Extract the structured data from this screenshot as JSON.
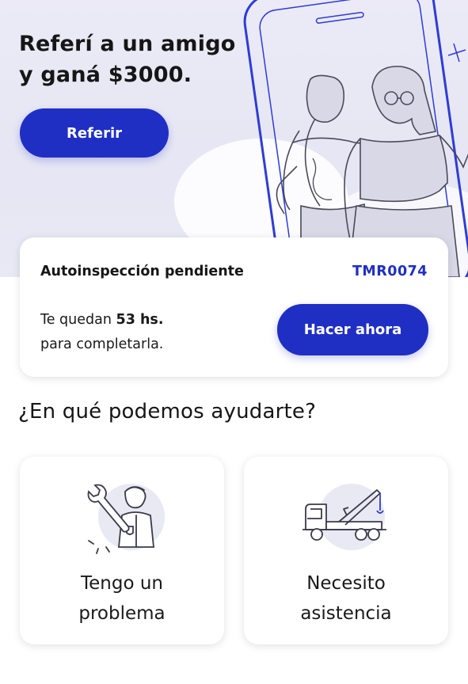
{
  "hero": {
    "title_line1": "Referí a un amigo",
    "title_line2": "y ganá $3000.",
    "refer_button": "Referir"
  },
  "pending": {
    "title": "Autoinspección pendiente",
    "code": "TMR0074",
    "text_prefix": "Te quedan",
    "hours": "53 hs.",
    "text_suffix": "para completarla.",
    "action_button": "Hacer ahora"
  },
  "help": {
    "title": "¿En qué podemos ayudarte?",
    "options": [
      {
        "label": "Tengo un problema",
        "icon": "mechanic-wrench-icon"
      },
      {
        "label": "Necesito asistencia",
        "icon": "tow-truck-icon"
      }
    ]
  },
  "colors": {
    "accent": "#1f2fc4",
    "hero_background": "#e7e6f4"
  }
}
